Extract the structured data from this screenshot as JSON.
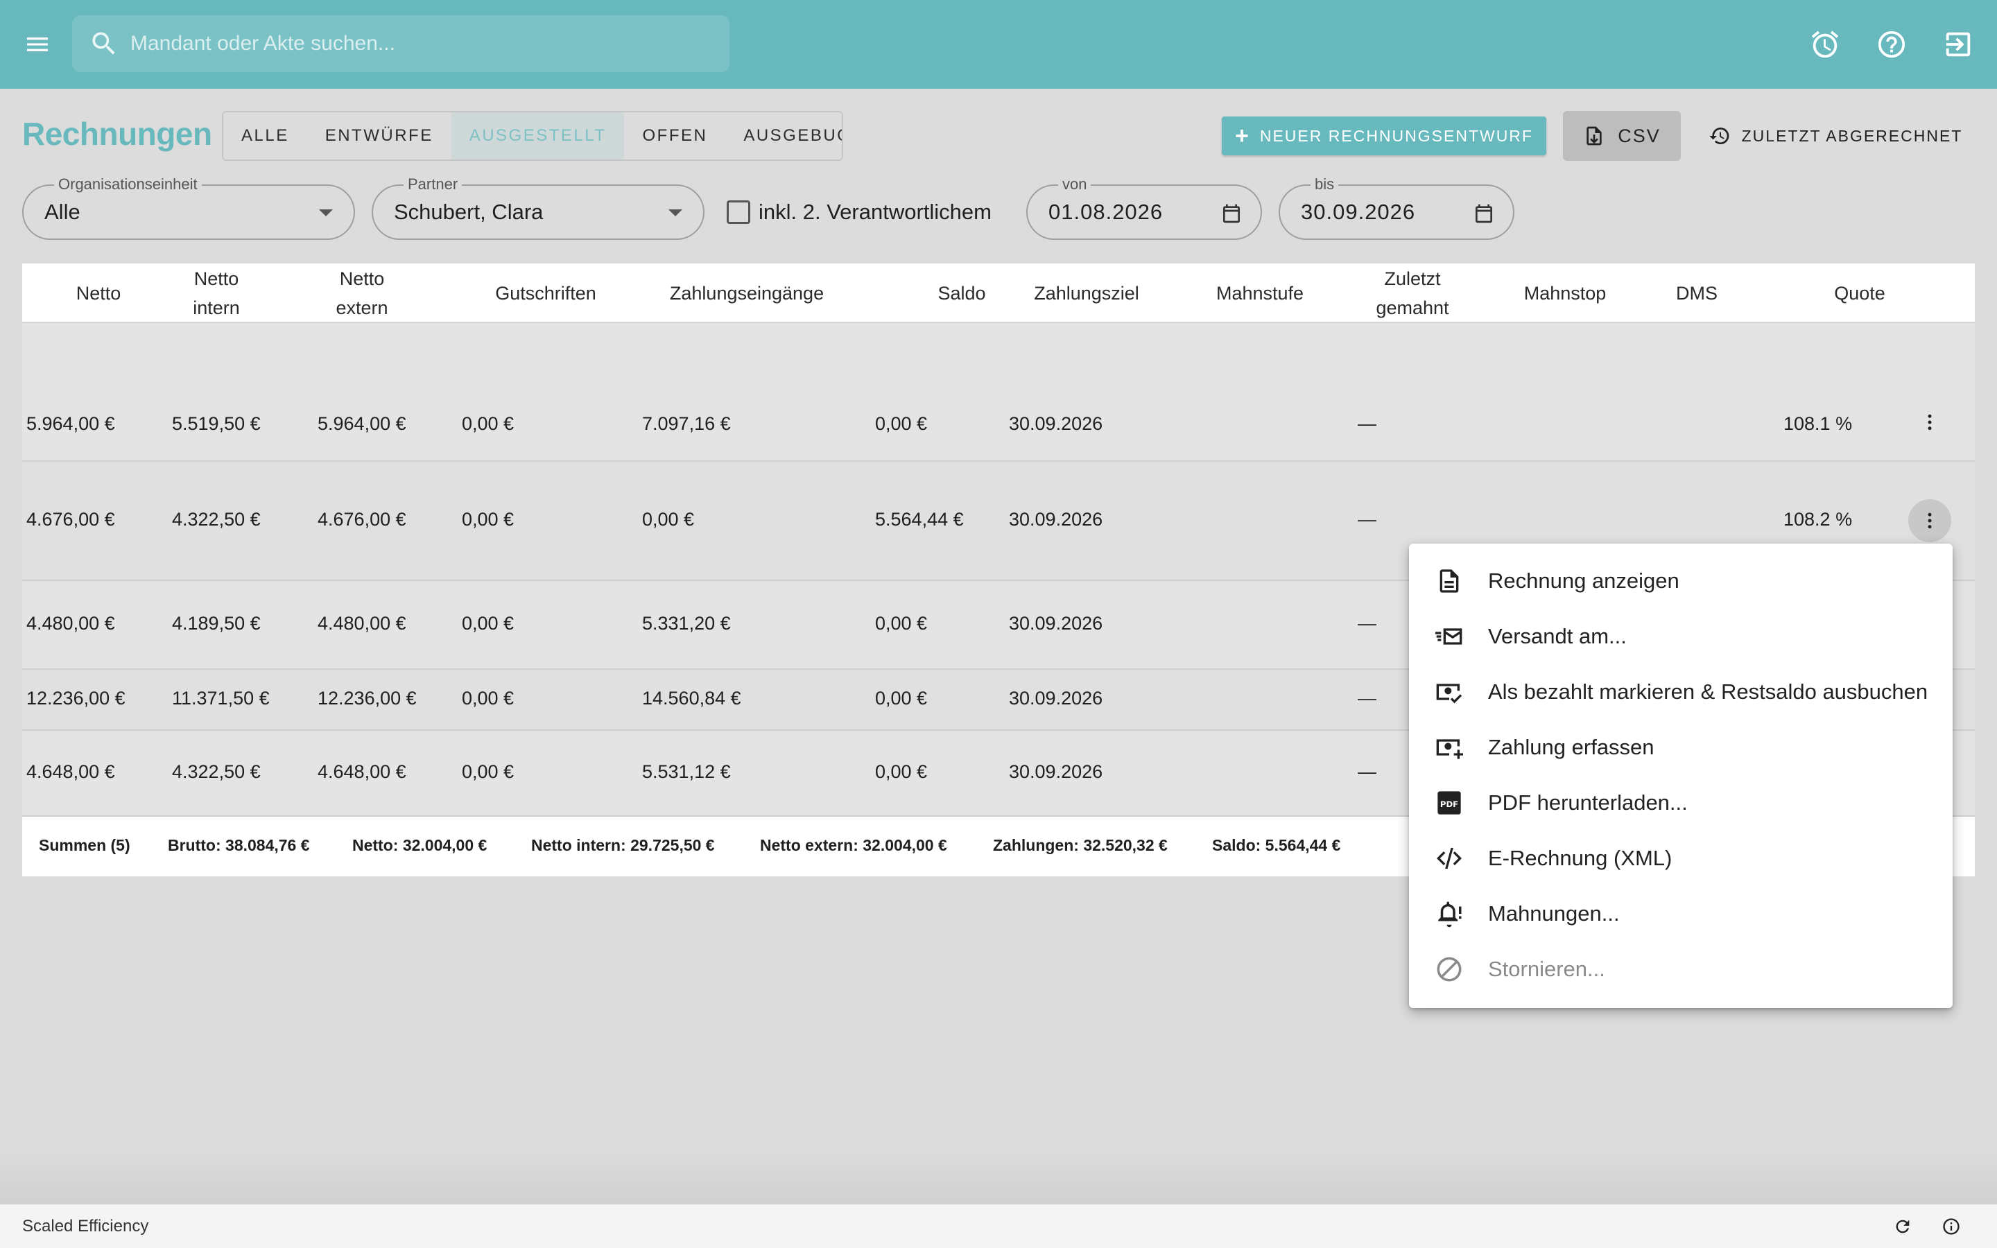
{
  "appbar": {
    "search_placeholder": "Mandant oder Akte suchen..."
  },
  "toolbar": {
    "title": "Rechnungen",
    "tabs": [
      {
        "label": "ALLE",
        "active": false
      },
      {
        "label": "ENTWÜRFE",
        "active": false
      },
      {
        "label": "AUSGESTELLT",
        "active": true
      },
      {
        "label": "OFFEN",
        "active": false
      },
      {
        "label": "AUSGEBUCHT",
        "active": false
      }
    ],
    "new_draft_label": "NEUER RECHNUNGSENTWURF",
    "csv_label": "CSV",
    "last_billed_label": "ZULETZT ABGERECHNET"
  },
  "filters": {
    "org_unit": {
      "label": "Organisationseinheit",
      "value": "Alle"
    },
    "partner": {
      "label": "Partner",
      "value": "Schubert, Clara"
    },
    "second_responsible_label": "inkl. 2. Verantwortlichem",
    "from": {
      "label": "von",
      "value": "01.08.2026"
    },
    "to": {
      "label": "bis",
      "value": "30.09.2026"
    }
  },
  "table": {
    "headers": {
      "netto": "Netto",
      "netto_intern_1": "Netto",
      "netto_intern_2": "intern",
      "netto_extern_1": "Netto",
      "netto_extern_2": "extern",
      "gutschriften": "Gutschriften",
      "zahlungseingaenge": "Zahlungseingänge",
      "saldo": "Saldo",
      "zahlungsziel": "Zahlungsziel",
      "mahnstufe": "Mahnstufe",
      "zuletzt_1": "Zuletzt",
      "zuletzt_2": "gemahnt",
      "mahnstop": "Mahnstop",
      "dms": "DMS",
      "quote": "Quote"
    },
    "rows": [
      {
        "netto": "5.964,00 €",
        "intern": "5.519,50 €",
        "extern": "5.964,00 €",
        "gutschriften": "0,00 €",
        "zahlungen": "7.097,16 €",
        "saldo": "0,00 €",
        "ziel": "30.09.2026",
        "gemahnt": "—",
        "quote": "108.1 %"
      },
      {
        "netto": "4.676,00 €",
        "intern": "4.322,50 €",
        "extern": "4.676,00 €",
        "gutschriften": "0,00 €",
        "zahlungen": "0,00 €",
        "saldo": "5.564,44 €",
        "ziel": "30.09.2026",
        "gemahnt": "—",
        "quote": "108.2 %"
      },
      {
        "netto": "4.480,00 €",
        "intern": "4.189,50 €",
        "extern": "4.480,00 €",
        "gutschriften": "0,00 €",
        "zahlungen": "5.331,20 €",
        "saldo": "0,00 €",
        "ziel": "30.09.2026",
        "gemahnt": "—",
        "quote": ""
      },
      {
        "netto": "12.236,00 €",
        "intern": "11.371,50 €",
        "extern": "12.236,00 €",
        "gutschriften": "0,00 €",
        "zahlungen": "14.560,84 €",
        "saldo": "0,00 €",
        "ziel": "30.09.2026",
        "gemahnt": "—",
        "quote": ""
      },
      {
        "netto": "4.648,00 €",
        "intern": "4.322,50 €",
        "extern": "4.648,00 €",
        "gutschriften": "0,00 €",
        "zahlungen": "5.531,12 €",
        "saldo": "0,00 €",
        "ziel": "30.09.2026",
        "gemahnt": "—",
        "quote": ""
      }
    ],
    "summary": {
      "count": "Summen (5)",
      "brutto": "Brutto: 38.084,76 €",
      "netto": "Netto: 32.004,00 €",
      "netto_intern": "Netto intern: 29.725,50 €",
      "netto_extern": "Netto extern: 32.004,00 €",
      "zahlungen": "Zahlungen: 32.520,32 €",
      "saldo": "Saldo: 5.564,44 €"
    }
  },
  "context_menu": {
    "items": [
      {
        "label": "Rechnung anzeigen",
        "icon": "document-icon"
      },
      {
        "label": "Versandt am...",
        "icon": "send-mail-icon"
      },
      {
        "label": "Als bezahlt markieren & Restsaldo ausbuchen",
        "icon": "money-check-icon"
      },
      {
        "label": "Zahlung erfassen",
        "icon": "money-add-icon"
      },
      {
        "label": "PDF herunterladen...",
        "icon": "pdf-icon"
      },
      {
        "label": "E-Rechnung (XML)",
        "icon": "code-icon"
      },
      {
        "label": "Mahnungen...",
        "icon": "bell-alert-icon"
      },
      {
        "label": "Stornieren...",
        "icon": "cancel-icon",
        "disabled": true
      }
    ]
  },
  "statusbar": {
    "brand": "Scaled Efficiency"
  },
  "colors": {
    "primary": "#67b9bd",
    "background": "#dcdcdc"
  }
}
